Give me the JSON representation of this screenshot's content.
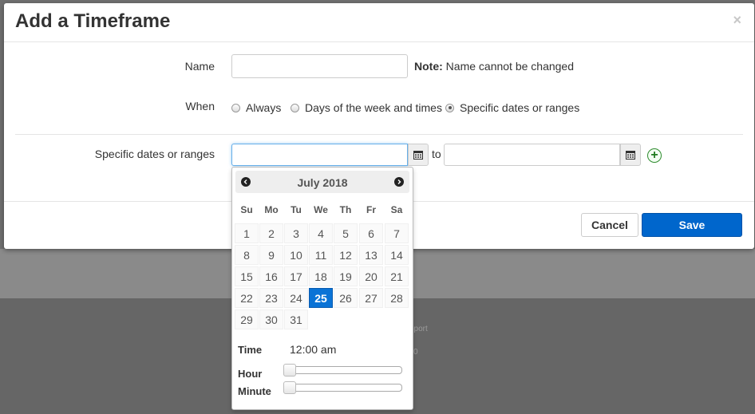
{
  "background": {
    "text_1": "pport",
    "text_2": "0"
  },
  "modal": {
    "title": "Add a Timeframe",
    "close": "×",
    "name": {
      "label": "Name",
      "value": "",
      "note_bold": "Note:",
      "note_text": " Name cannot be changed"
    },
    "when": {
      "label": "When",
      "options": [
        {
          "label": "Always",
          "checked": false
        },
        {
          "label": "Days of the week and times",
          "checked": false
        },
        {
          "label": "Specific dates or ranges",
          "checked": true
        }
      ]
    },
    "dates": {
      "label": "Specific dates or ranges",
      "from_value": "",
      "to_label": "to",
      "to_value": ""
    },
    "footer": {
      "cancel": "Cancel",
      "save": "Save"
    }
  },
  "datepicker": {
    "month_title": "July 2018",
    "weekdays": [
      "Su",
      "Mo",
      "Tu",
      "We",
      "Th",
      "Fr",
      "Sa"
    ],
    "weeks": [
      [
        "1",
        "2",
        "3",
        "4",
        "5",
        "6",
        "7"
      ],
      [
        "8",
        "9",
        "10",
        "11",
        "12",
        "13",
        "14"
      ],
      [
        "15",
        "16",
        "17",
        "18",
        "19",
        "20",
        "21"
      ],
      [
        "22",
        "23",
        "24",
        "25",
        "26",
        "27",
        "28"
      ],
      [
        "29",
        "30",
        "31"
      ]
    ],
    "selected_day": "25",
    "time_label": "Time",
    "time_value": "12:00 am",
    "hour_label": "Hour",
    "minute_label": "Minute",
    "hour_level": 0,
    "minute_level": 0
  },
  "colors": {
    "accent": "#0066cc",
    "selected_day": "#0a73d6",
    "add_icon": "#2e8b2e"
  }
}
